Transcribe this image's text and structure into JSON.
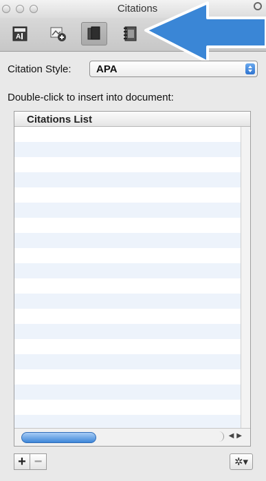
{
  "window": {
    "title": "Citations"
  },
  "toolbar": {
    "buttons": [
      {
        "icon": "style-manager-icon"
      },
      {
        "icon": "add-citation-icon"
      },
      {
        "icon": "citations-list-icon",
        "selected": true
      },
      {
        "icon": "bibliography-icon"
      }
    ]
  },
  "citation_style": {
    "label": "Citation Style:",
    "value": "APA"
  },
  "hint": "Double-click to insert into document:",
  "list": {
    "header": "Citations List",
    "rows": []
  },
  "bottom": {
    "add": "+",
    "remove": "−",
    "gear": "✲▾"
  },
  "colors": {
    "accent": "#2f74d0",
    "arrow": "#3a86d6"
  }
}
